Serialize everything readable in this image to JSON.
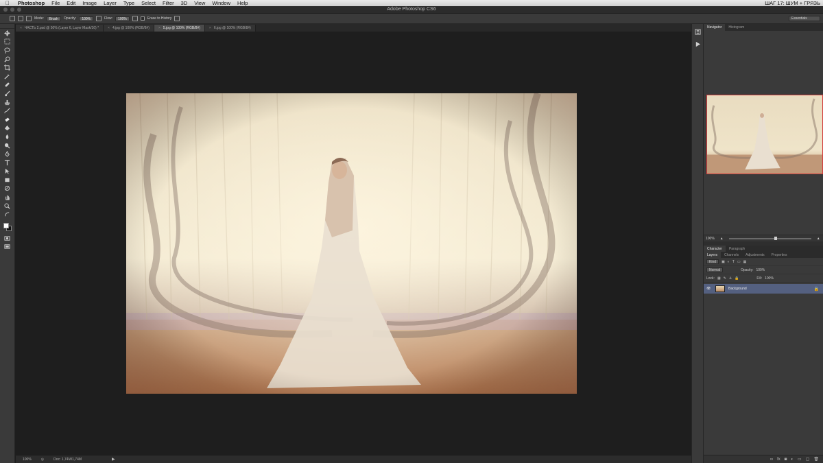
{
  "menubar": {
    "app_name": "Photoshop",
    "items": [
      "File",
      "Edit",
      "Image",
      "Layer",
      "Type",
      "Select",
      "Filter",
      "3D",
      "View",
      "Window",
      "Help"
    ],
    "right_text": "ШАГ 17: ШУМ + ГРЯЗЬ"
  },
  "window": {
    "title": "Adobe Photoshop CS6"
  },
  "options": {
    "mode_label": "Mode:",
    "mode_value": "Brush",
    "opacity_label": "Opacity:",
    "opacity_value": "100%",
    "flow_label": "Flow:",
    "flow_value": "100%",
    "erase_history_label": "Erase to History",
    "workspace": "Essentials"
  },
  "tabs": [
    {
      "label": "ЧАСТЬ 2.psd @ 50% (Layer 6, Layer Mask/16) *",
      "active": false
    },
    {
      "label": "4.jpg @ 100% (RGB/8#)",
      "active": false
    },
    {
      "label": "5.jpg @ 100% (RGB/8#)",
      "active": true
    },
    {
      "label": "6.jpg @ 100% (RGB/8#)",
      "active": false
    }
  ],
  "status": {
    "zoom": "100%",
    "doc": "Doc: 1,74M/1,74M"
  },
  "navigator": {
    "tabs": [
      "Navigator",
      "Histogram"
    ],
    "zoom": "100%"
  },
  "character_tabs": [
    "Character",
    "Paragraph"
  ],
  "layers": {
    "tabs": [
      "Layers",
      "Channels",
      "Adjustments",
      "Properties"
    ],
    "kind_label": "Kind",
    "blend_mode": "Normal",
    "opacity_label": "Opacity:",
    "opacity_value": "100%",
    "lock_label": "Lock:",
    "fill_label": "Fill:",
    "fill_value": "100%",
    "items": [
      {
        "name": "Background"
      }
    ]
  },
  "colors": {
    "accent_selected_layer": "#546080",
    "navigator_frame": "#d23b3b"
  }
}
